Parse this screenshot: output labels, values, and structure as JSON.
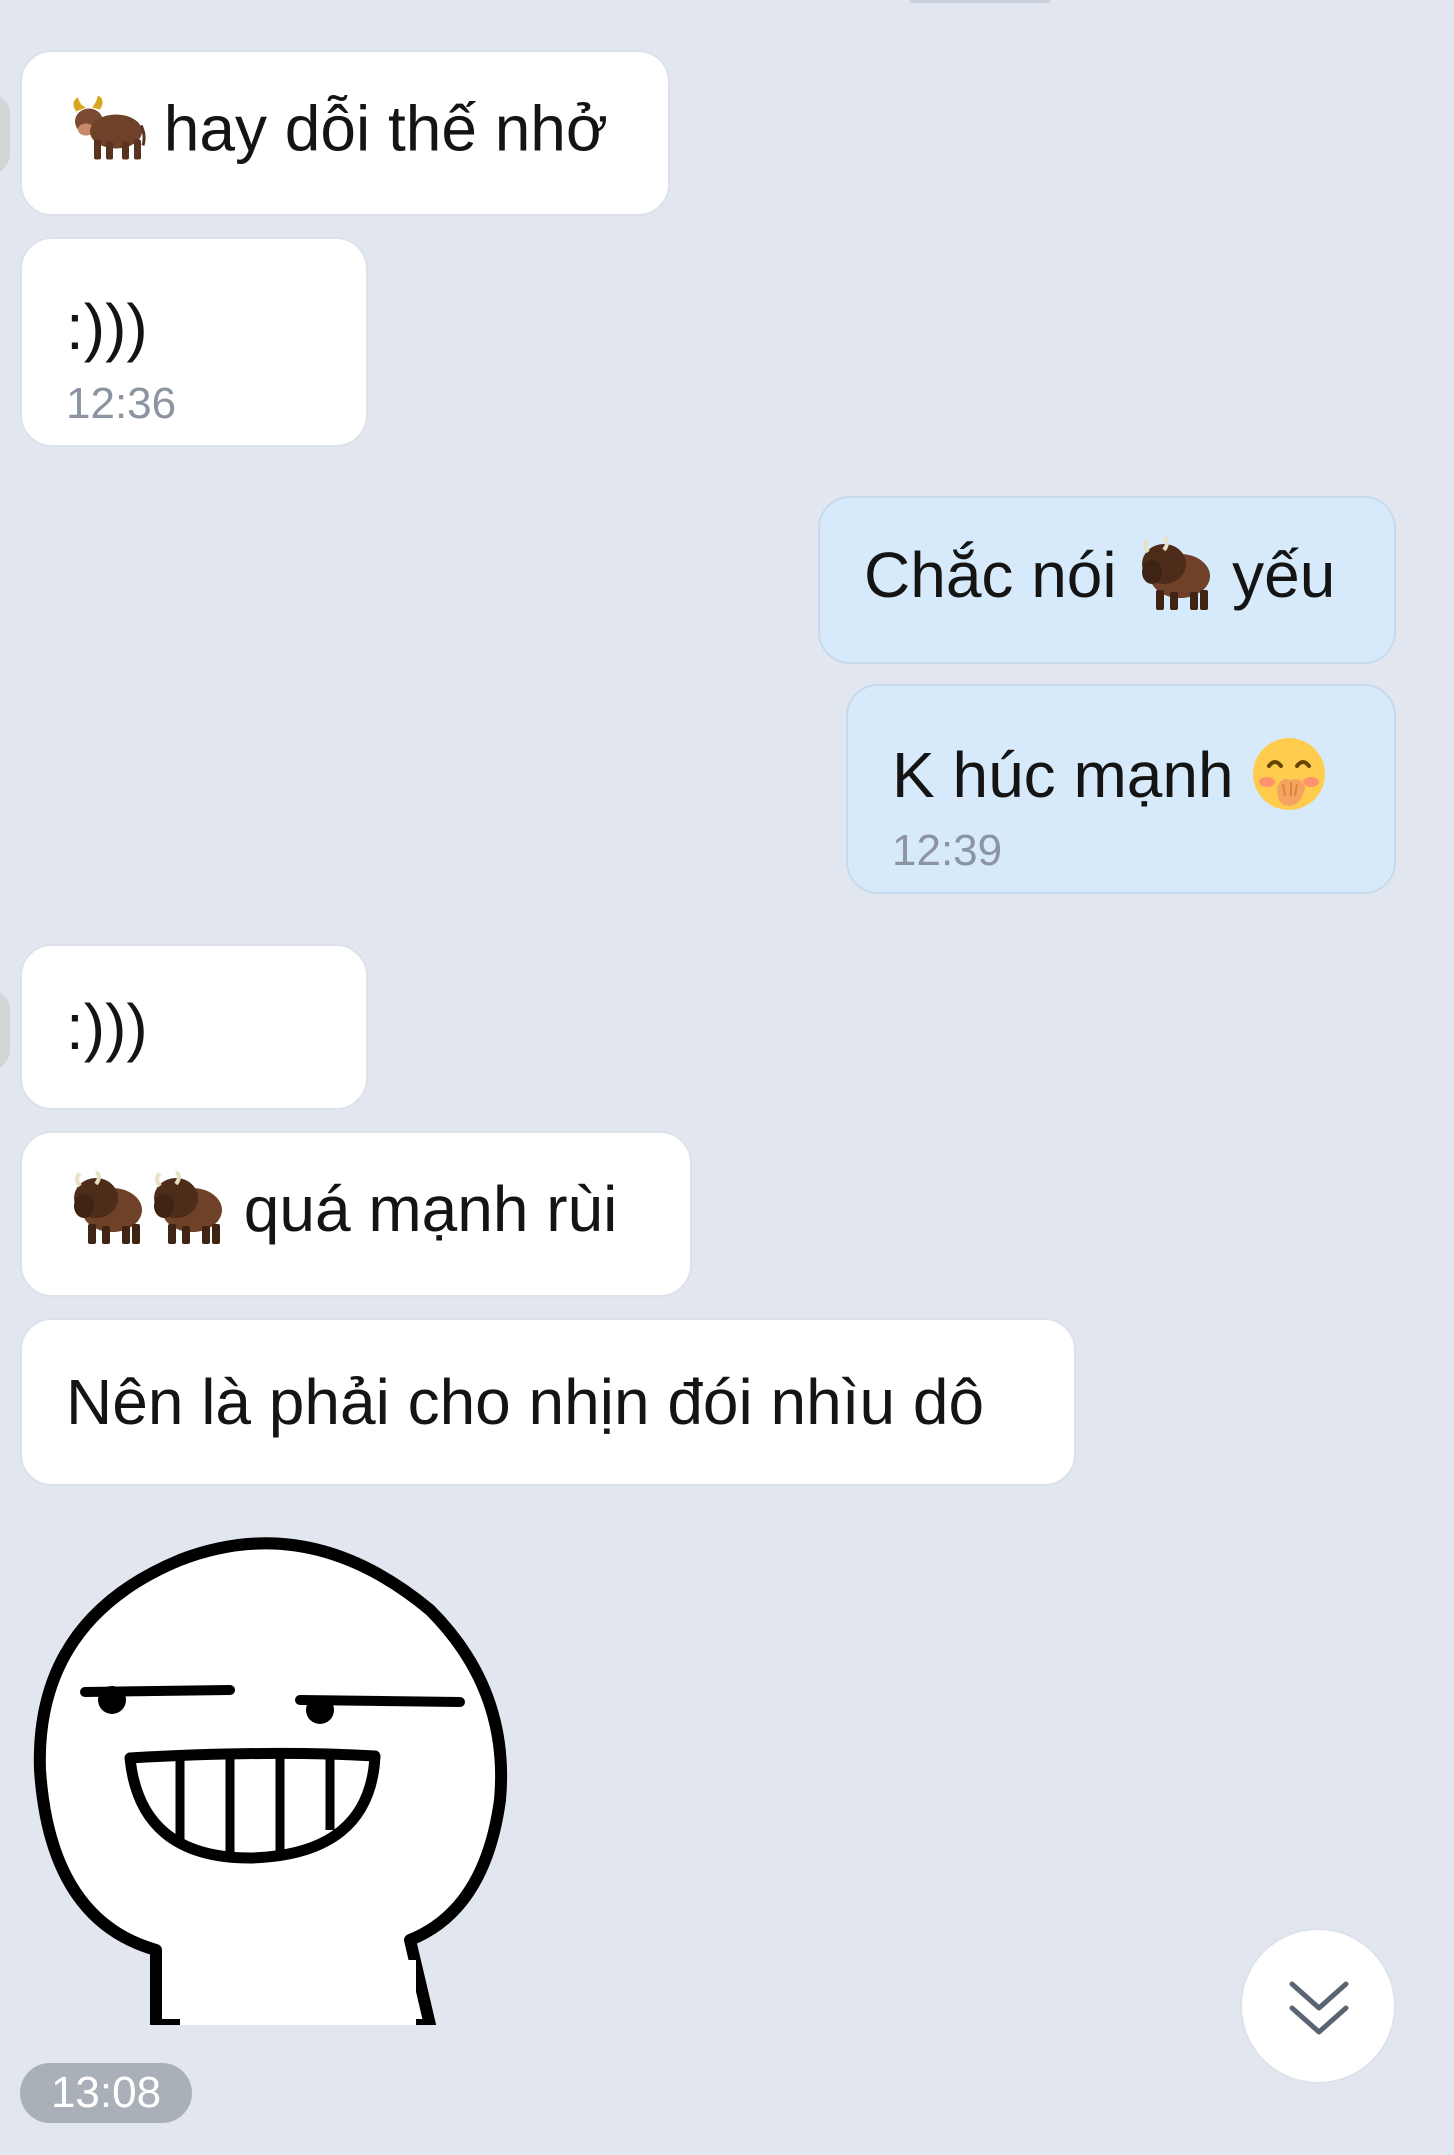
{
  "messages": [
    {
      "id": "m1",
      "side": "in",
      "emoji": [
        "ox-emoji"
      ],
      "text": "hay dỗi thế nhở",
      "time": ""
    },
    {
      "id": "m2",
      "side": "in",
      "text": ":)))",
      "time": "12:36"
    },
    {
      "id": "m3",
      "side": "out",
      "text_before": "Chắc nói",
      "emoji": [
        "bison-emoji"
      ],
      "text_after": "yếu",
      "time": ""
    },
    {
      "id": "m4",
      "side": "out",
      "text": "K húc mạnh",
      "emoji": [
        "hand-over-mouth-emoji"
      ],
      "time": "12:39"
    },
    {
      "id": "m5",
      "side": "in",
      "text": ":)))",
      "time": ""
    },
    {
      "id": "m6",
      "side": "in",
      "emoji": [
        "bison-emoji",
        "bison-emoji"
      ],
      "text": "quá mạnh rùi",
      "time": ""
    },
    {
      "id": "m7",
      "side": "in",
      "text": "Nên là phải cho nhịn đói nhìu dô",
      "time": ""
    }
  ],
  "sticker": {
    "icon": "smirking-grin-sticker"
  },
  "last_time": "13:08",
  "scroll_button": {
    "icon": "double-chevron-down-icon"
  },
  "colors": {
    "background": "#e2e7ef",
    "incoming_bubble": "#ffffff",
    "outgoing_bubble": "#d7eafb",
    "timestamp": "#8b94a0",
    "time_chip": "#a9b0b8"
  }
}
